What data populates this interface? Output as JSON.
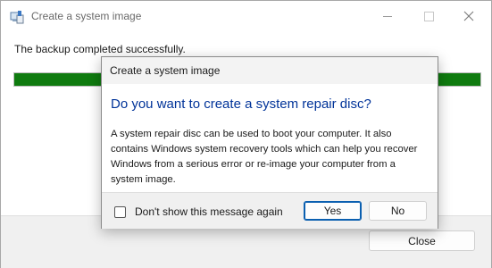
{
  "window": {
    "title": "Create a system image",
    "icon": "system-image-app-icon",
    "message": "The backup completed successfully.",
    "progress_percent": 100,
    "progress_color": "#0f7b0f",
    "close_label": "Close"
  },
  "dialog": {
    "title": "Create a system image",
    "heading": "Do you want to create a system repair disc?",
    "body": "A system repair disc can be used to boot your computer. It also contains Windows system recovery tools which can help you recover Windows from a serious error or re-image your computer from a system image.",
    "checkbox_label": "Don't show this message again",
    "checkbox_checked": false,
    "yes_label": "Yes",
    "no_label": "No",
    "heading_color": "#003399"
  }
}
